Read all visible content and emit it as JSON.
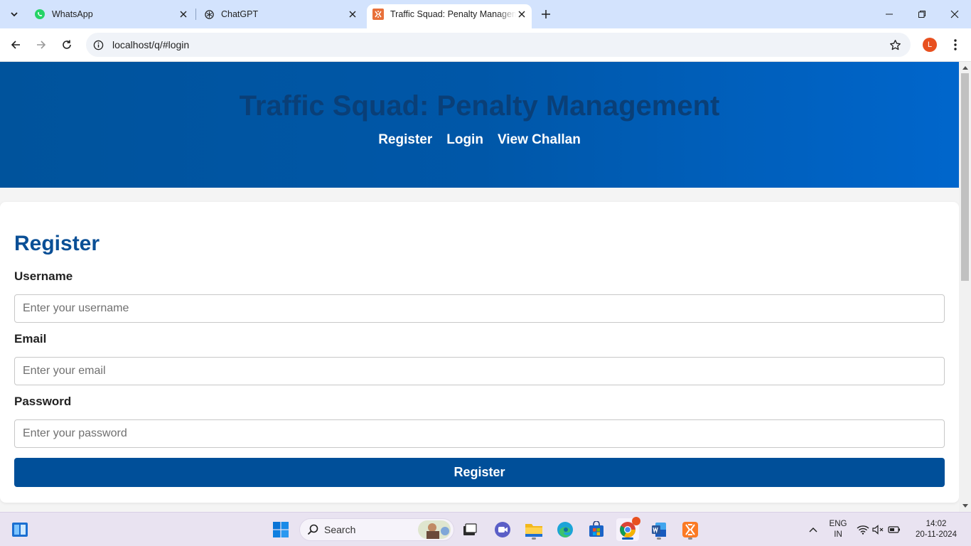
{
  "browser": {
    "tabs": [
      {
        "title": "WhatsApp",
        "icon": "whatsapp-icon"
      },
      {
        "title": "ChatGPT",
        "icon": "chatgpt-icon"
      },
      {
        "title": "Traffic Squad: Penalty Management",
        "icon": "xampp-icon",
        "active": true
      }
    ],
    "url": "localhost/q/#login",
    "profile_initial": "L"
  },
  "page": {
    "site_title": "Traffic Squad: Penalty Management",
    "nav": [
      "Register",
      "Login",
      "View Challan"
    ],
    "form": {
      "heading": "Register",
      "username_label": "Username",
      "username_placeholder": "Enter your username",
      "email_label": "Email",
      "email_placeholder": "Enter your email",
      "password_label": "Password",
      "password_placeholder": "Enter your password",
      "submit_label": "Register"
    }
  },
  "taskbar": {
    "search_label": "Search",
    "language": "ENG",
    "region": "IN",
    "time": "14:02",
    "date": "20-11-2024"
  },
  "colors": {
    "header_start": "#00539c",
    "header_end": "#0066cc",
    "heading": "#0a4f96",
    "button": "#004f99"
  }
}
